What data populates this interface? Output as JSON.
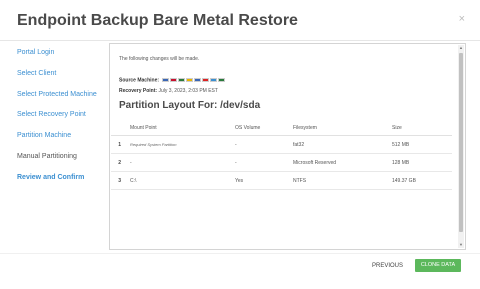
{
  "dialog": {
    "title": "Endpoint Backup Bare Metal Restore",
    "close_glyph": "×"
  },
  "sidebar": {
    "items": [
      {
        "label": "Portal Login",
        "state": "link"
      },
      {
        "label": "Select Client",
        "state": "link"
      },
      {
        "label": "Select Protected Machine",
        "state": "link"
      },
      {
        "label": "Select Recovery Point",
        "state": "link"
      },
      {
        "label": "Partition Machine",
        "state": "link"
      },
      {
        "label": "Manual Partitioning",
        "state": "current"
      },
      {
        "label": "Review and Confirm",
        "state": "active"
      }
    ]
  },
  "main": {
    "intro": "The following changes will be made.",
    "source_label": "Source Machine:",
    "recovery_label": "Recovery Point:",
    "recovery_value": "July 3, 2023, 2:03 PM EST",
    "subtitle": "Partition Layout For: /dev/sda",
    "flag_colors": [
      "#3a66b5",
      "#c8102e",
      "#2a7a3b",
      "#e8b400",
      "#3a66b5",
      "#d22",
      "#3b8fd1",
      "#2a7a3b"
    ],
    "table": {
      "headers": {
        "mount": "Mount Point",
        "os": "OS Volume",
        "fs": "Filesystem",
        "size": "Size"
      },
      "rows": [
        {
          "num": "1",
          "mount": "Required System Partition",
          "os": "-",
          "fs": "fat32",
          "size": "512 MB"
        },
        {
          "num": "2",
          "mount": "-",
          "os": "-",
          "fs": "Microsoft Reserved",
          "size": "128 MB"
        },
        {
          "num": "3",
          "mount": "C:\\",
          "os": "Yes",
          "fs": "NTFS",
          "size": "149.37 GB"
        }
      ]
    }
  },
  "footer": {
    "previous_label": "PREVIOUS",
    "clone_label": "CLONE DATA"
  },
  "colors": {
    "link": "#3b8fd1",
    "primary_button": "#5cb85c",
    "title": "#4a4a4a"
  }
}
